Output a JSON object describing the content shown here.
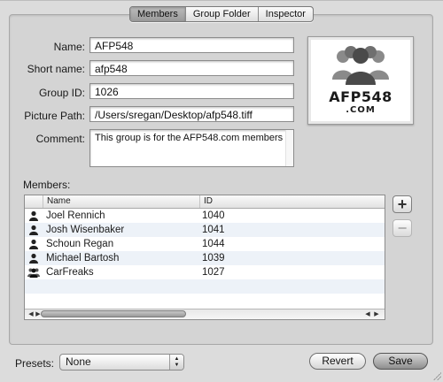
{
  "tabs": [
    {
      "label": "Members",
      "active": true
    },
    {
      "label": "Group Folder",
      "active": false
    },
    {
      "label": "Inspector",
      "active": false
    }
  ],
  "form": {
    "name_label": "Name:",
    "name_value": "AFP548",
    "short_name_label": "Short name:",
    "short_name_value": "afp548",
    "group_id_label": "Group ID:",
    "group_id_value": "1026",
    "picture_path_label": "Picture Path:",
    "picture_path_value": "/Users/sregan/Desktop/afp548.tiff",
    "comment_label": "Comment:",
    "comment_value": "This group is for the AFP548.com members"
  },
  "picture": {
    "logo_text": "AFP548",
    "logo_subtext": ".COM"
  },
  "members": {
    "label": "Members:",
    "columns": [
      "Name",
      "ID"
    ],
    "rows": [
      {
        "name": "Joel Rennich",
        "id": "1040",
        "icon": "user-icon"
      },
      {
        "name": "Josh Wisenbaker",
        "id": "1041",
        "icon": "user-icon"
      },
      {
        "name": "Schoun Regan",
        "id": "1044",
        "icon": "user-icon"
      },
      {
        "name": "Michael Bartosh",
        "id": "1039",
        "icon": "user-icon"
      },
      {
        "name": "CarFreaks",
        "id": "1027",
        "icon": "group-icon"
      }
    ],
    "add_label": "+",
    "remove_label": "−"
  },
  "footer": {
    "presets_label": "Presets:",
    "presets_value": "None",
    "revert_label": "Revert",
    "save_label": "Save"
  }
}
